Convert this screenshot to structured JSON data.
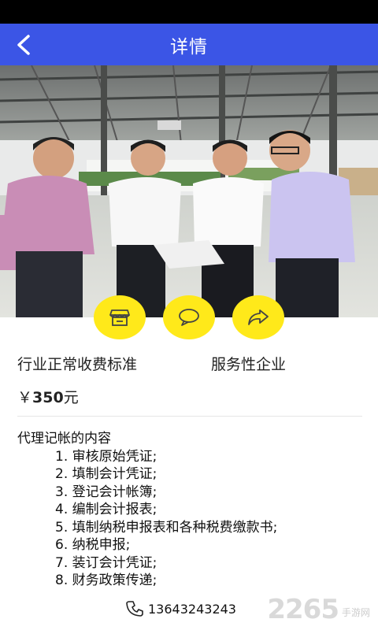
{
  "header": {
    "title": "详情"
  },
  "info": {
    "left_label": "行业正常收费标准",
    "right_label": "服务性企业",
    "price_symbol": "￥",
    "price_value": "350",
    "price_unit": "元"
  },
  "description": {
    "title": "代理记帐的内容",
    "items": [
      "1. 审核原始凭证;",
      "2. 填制会计凭证;",
      "3. 登记会计帐簿;",
      "4. 编制会计报表;",
      "5. 填制纳税申报表和各种税费缴款书;",
      "6. 纳税申报;",
      "7. 装订会计凭证;",
      "8. 财务政策传递;"
    ]
  },
  "contact": {
    "phone": "13643243243"
  },
  "watermark": {
    "number": "2265",
    "site": "手游网"
  },
  "colors": {
    "nav": "#3b55e6",
    "action": "#ffe91a"
  },
  "icons": [
    "back-arrow-icon",
    "store-icon",
    "chat-icon",
    "share-icon",
    "phone-icon"
  ]
}
